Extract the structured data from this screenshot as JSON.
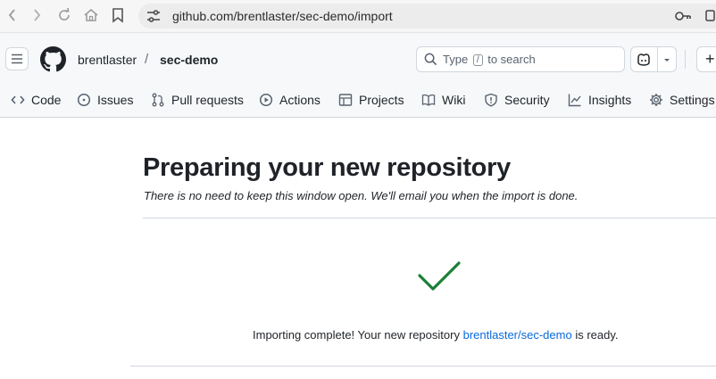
{
  "browser": {
    "url": "github.com/brentlaster/sec-demo/import"
  },
  "header": {
    "owner": "brentlaster",
    "separator": "/",
    "repo": "sec-demo",
    "search": {
      "prefix": "Type",
      "key": "/",
      "suffix": "to search"
    },
    "plus_label": "+"
  },
  "tabs": [
    {
      "label": "Code",
      "icon": "code-icon"
    },
    {
      "label": "Issues",
      "icon": "issue-icon"
    },
    {
      "label": "Pull requests",
      "icon": "pull-request-icon"
    },
    {
      "label": "Actions",
      "icon": "play-icon"
    },
    {
      "label": "Projects",
      "icon": "table-icon"
    },
    {
      "label": "Wiki",
      "icon": "book-icon"
    },
    {
      "label": "Security",
      "icon": "shield-icon"
    },
    {
      "label": "Insights",
      "icon": "graph-icon"
    },
    {
      "label": "Settings",
      "icon": "gear-icon"
    }
  ],
  "main": {
    "title": "Preparing your new repository",
    "subtitle": "There is no need to keep this window open. We'll email you when the import is done.",
    "status_prefix": "Importing complete! Your new repository",
    "status_link": "brentlaster/sec-demo",
    "status_suffix": "is ready."
  },
  "colors": {
    "accent_link": "#0969da",
    "success": "#1a7f37"
  }
}
